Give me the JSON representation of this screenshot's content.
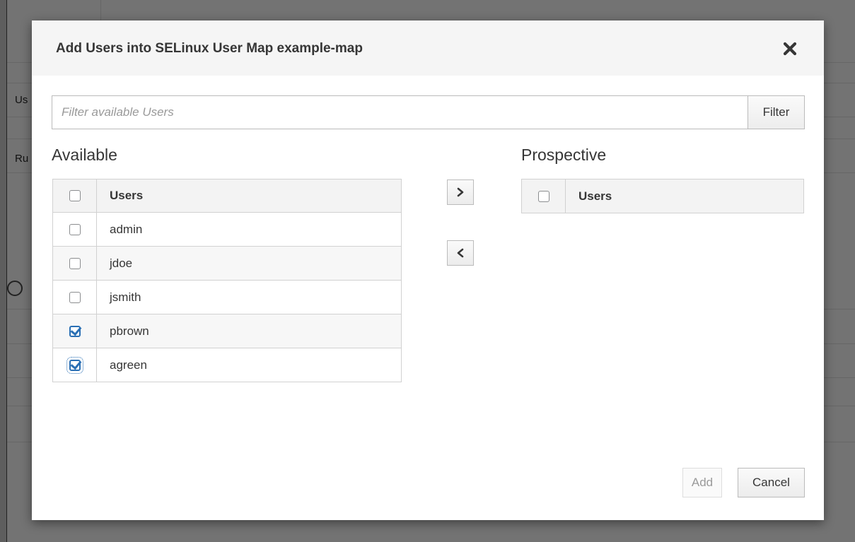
{
  "background": {
    "labels": [
      "Us",
      "Ru"
    ]
  },
  "dialog": {
    "title": "Add Users into SELinux User Map example-map",
    "close_icon": "close-icon"
  },
  "filter": {
    "placeholder": "Filter available Users",
    "button_label": "Filter"
  },
  "available": {
    "label": "Available",
    "column_header": "Users",
    "rows": [
      {
        "name": "admin",
        "checked": false
      },
      {
        "name": "jdoe",
        "checked": false
      },
      {
        "name": "jsmith",
        "checked": false
      },
      {
        "name": "pbrown",
        "checked": true
      },
      {
        "name": "agreen",
        "checked": true
      }
    ]
  },
  "prospective": {
    "label": "Prospective",
    "column_header": "Users",
    "rows": []
  },
  "move_buttons": {
    "add_icon": "chevron-right-icon",
    "remove_icon": "chevron-left-icon"
  },
  "footer": {
    "add_label": "Add",
    "cancel_label": "Cancel"
  },
  "colors": {
    "accent": "#2a6fb4",
    "header_bg": "#f5f5f5"
  }
}
